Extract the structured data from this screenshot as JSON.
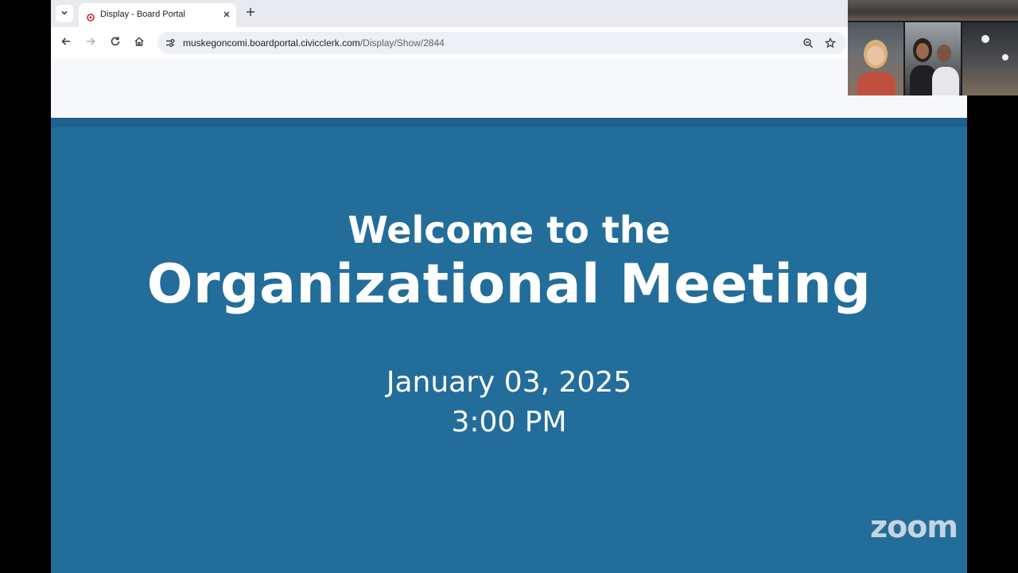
{
  "browser": {
    "tab": {
      "title": "Display - Board Portal"
    },
    "url": {
      "domain": "muskegoncomi.boardportal.civicclerk.com",
      "path": "/Display/Show/2844"
    }
  },
  "slide": {
    "welcome": "Welcome to the",
    "title": "Organizational Meeting",
    "date": "January 03, 2025",
    "time": "3:00 PM",
    "background_color": "#236d9b"
  },
  "zoom": {
    "logo_text": "zoom"
  },
  "icons": {
    "tab_menu": "chevron-down-icon",
    "favicon": "civicclerk-favicon",
    "tab_close": "close-icon",
    "new_tab": "plus-icon",
    "back": "arrow-left-icon",
    "forward": "arrow-right-icon",
    "reload": "reload-icon",
    "home": "home-icon",
    "site_info": "tune-icon",
    "zoom": "magnifier-icon",
    "bookmark": "star-icon"
  }
}
